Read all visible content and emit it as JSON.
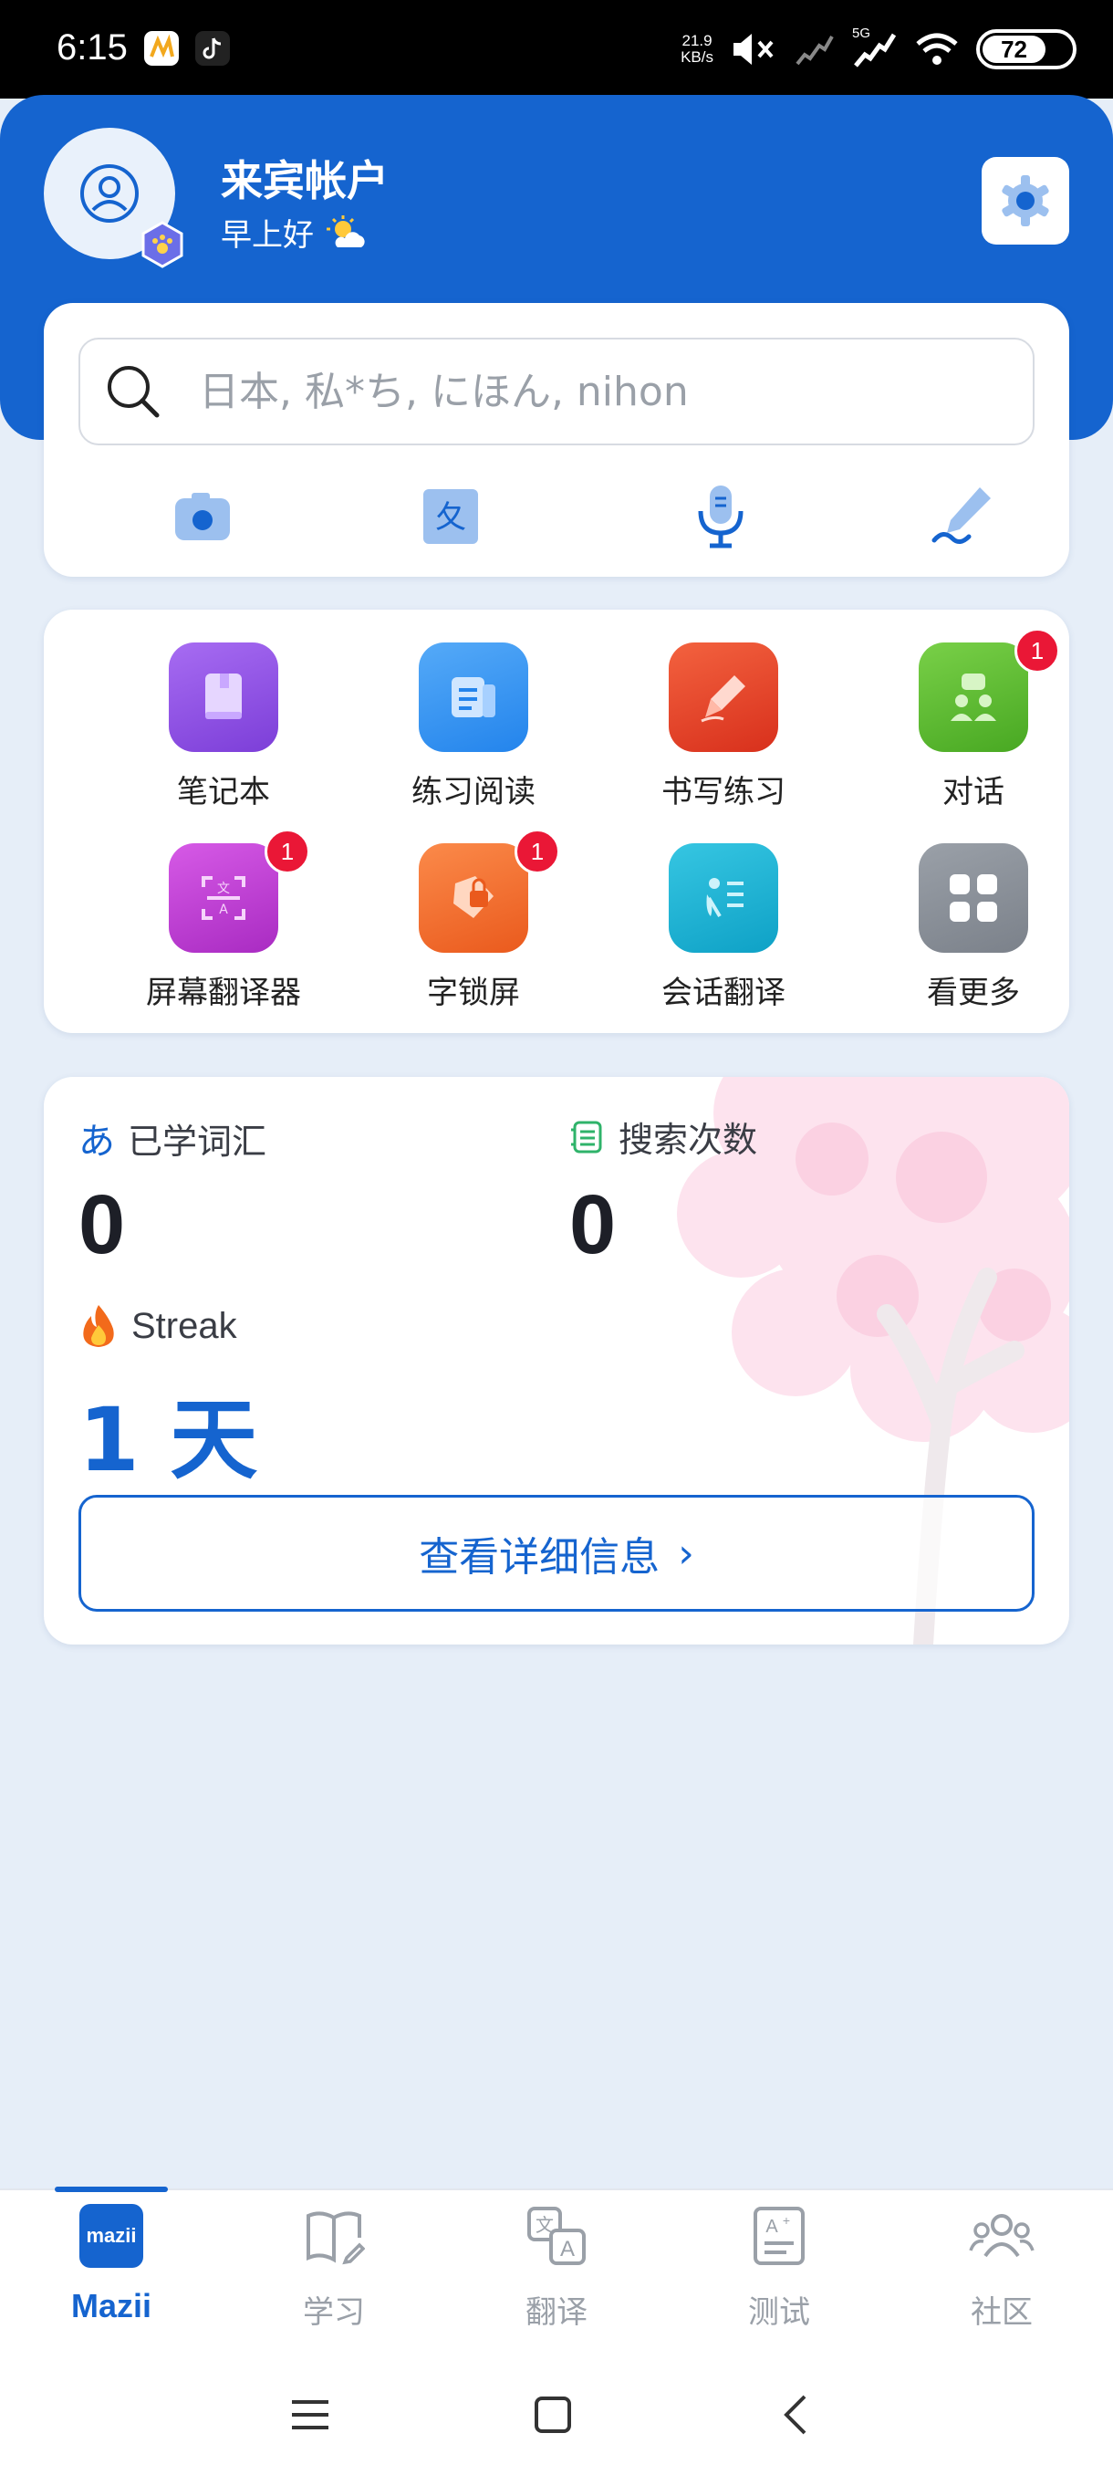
{
  "status_bar": {
    "time": "6:15",
    "net_speed_value": "21.9",
    "net_speed_unit": "KB/s",
    "network": "5G",
    "battery": "72",
    "icons": [
      "mute-icon",
      "signal-icon",
      "signal-5g-icon",
      "wifi-icon",
      "battery-icon"
    ]
  },
  "header": {
    "account_title": "来宾帐户",
    "greeting": "早上好",
    "greeting_icon": "sun-cloud-icon"
  },
  "search": {
    "placeholder": "日本, 私*ち, にほん, nihon",
    "tools": [
      "camera-icon",
      "translate-icon",
      "microphone-icon",
      "handwriting-icon"
    ]
  },
  "apps": [
    {
      "label": "笔记本",
      "badge": null,
      "color": "#8a4de0",
      "icon": "notebook-icon"
    },
    {
      "label": "练习阅读",
      "badge": null,
      "color": "#2f8ff0",
      "icon": "reading-icon"
    },
    {
      "label": "书写练习",
      "badge": null,
      "color": "#e7402a",
      "icon": "pen-icon"
    },
    {
      "label": "对话",
      "badge": "1",
      "color": "#56b830",
      "icon": "conversation-icon"
    },
    {
      "label": "屏幕翻译器",
      "badge": "1",
      "color": "#c43fd6",
      "icon": "screen-translate-icon"
    },
    {
      "label": "字锁屏",
      "badge": "1",
      "color": "#f2702e",
      "icon": "lock-screen-icon"
    },
    {
      "label": "会话翻译",
      "badge": null,
      "color": "#1bb4d4",
      "icon": "talk-translate-icon"
    },
    {
      "label": "看更多",
      "badge": null,
      "color": "#8b9199",
      "icon": "grid-more-icon"
    }
  ],
  "stats": {
    "learned_vocab_label": "已学词汇",
    "learned_vocab_icon_char": "あ",
    "learned_vocab_value": "0",
    "search_count_label": "搜索次数",
    "search_count_value": "0",
    "streak_label": "Streak",
    "streak_value": "1 天",
    "detail_button": "查看详细信息",
    "detail_chevron": "›"
  },
  "bottom_nav": [
    {
      "label": "Mazii",
      "active": true,
      "icon": "mazii-logo-icon",
      "logo_text": "mazii"
    },
    {
      "label": "学习",
      "active": false,
      "icon": "book-icon"
    },
    {
      "label": "翻译",
      "active": false,
      "icon": "translate-icon"
    },
    {
      "label": "测试",
      "active": false,
      "icon": "test-icon"
    },
    {
      "label": "社区",
      "active": false,
      "icon": "community-icon"
    }
  ]
}
